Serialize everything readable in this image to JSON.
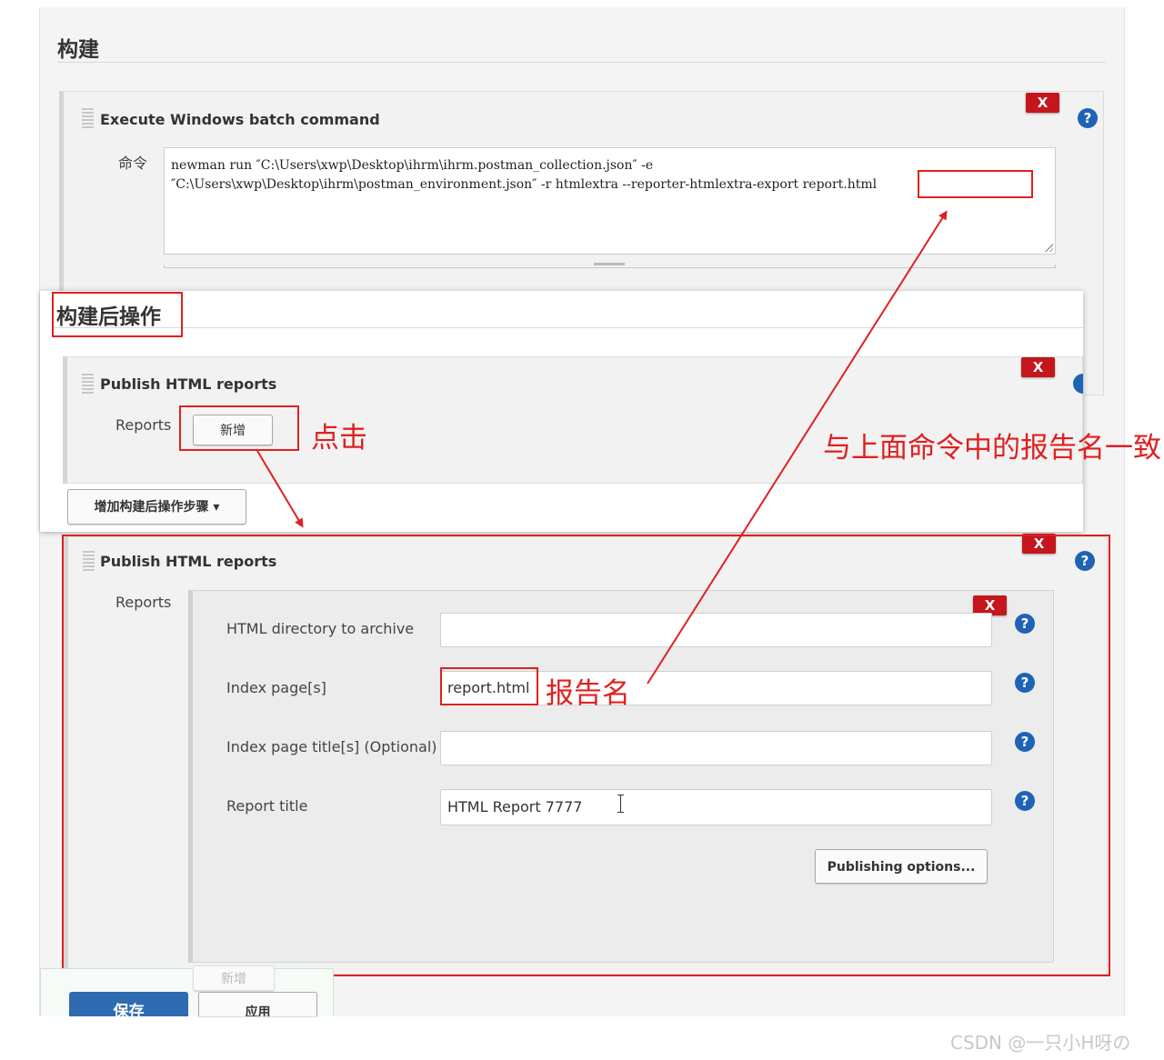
{
  "build": {
    "section_title": "构建",
    "step_title": "Execute Windows batch command",
    "command_label": "命令",
    "command_line1": "newman run ″C:\\Users\\xwp\\Desktop\\ihrm\\ihrm.postman_collection.json″ -e",
    "command_line2": "″C:\\Users\\xwp\\Desktop\\ihrm\\postman_environment.json″ -r htmlextra --reporter-htmlextra-export ",
    "command_report": "report.html",
    "delete_label": "X",
    "help_label": "?"
  },
  "post_build": {
    "section_title": "构建后操作",
    "step_title": "Publish HTML reports",
    "reports_label": "Reports",
    "add_button": "新增",
    "add_step_button": "增加构建后操作步骤",
    "dropdown_arrow": "▾",
    "delete_label": "X",
    "help_label": "?"
  },
  "publish": {
    "step_title": "Publish HTML reports",
    "reports_label": "Reports",
    "delete_label": "X",
    "inner_delete_label": "X",
    "help_label": "?",
    "fields": [
      {
        "label": "HTML directory to archive",
        "value": ""
      },
      {
        "label": "Index page[s]",
        "value": "report.html"
      },
      {
        "label": "Index page title[s] (Optional)",
        "value": ""
      },
      {
        "label": "Report title",
        "value": "HTML Report 7777"
      }
    ],
    "publishing_options_button": "Publishing options..."
  },
  "footer": {
    "add_button_faded": "新增",
    "save_button": "保存",
    "apply_button": "应用"
  },
  "annotations": {
    "click": "点击",
    "same_name": "与上面命令中的报告名一致",
    "report_name": "报告名",
    "color": "#e02020"
  },
  "watermark": "CSDN @一只小H呀の"
}
